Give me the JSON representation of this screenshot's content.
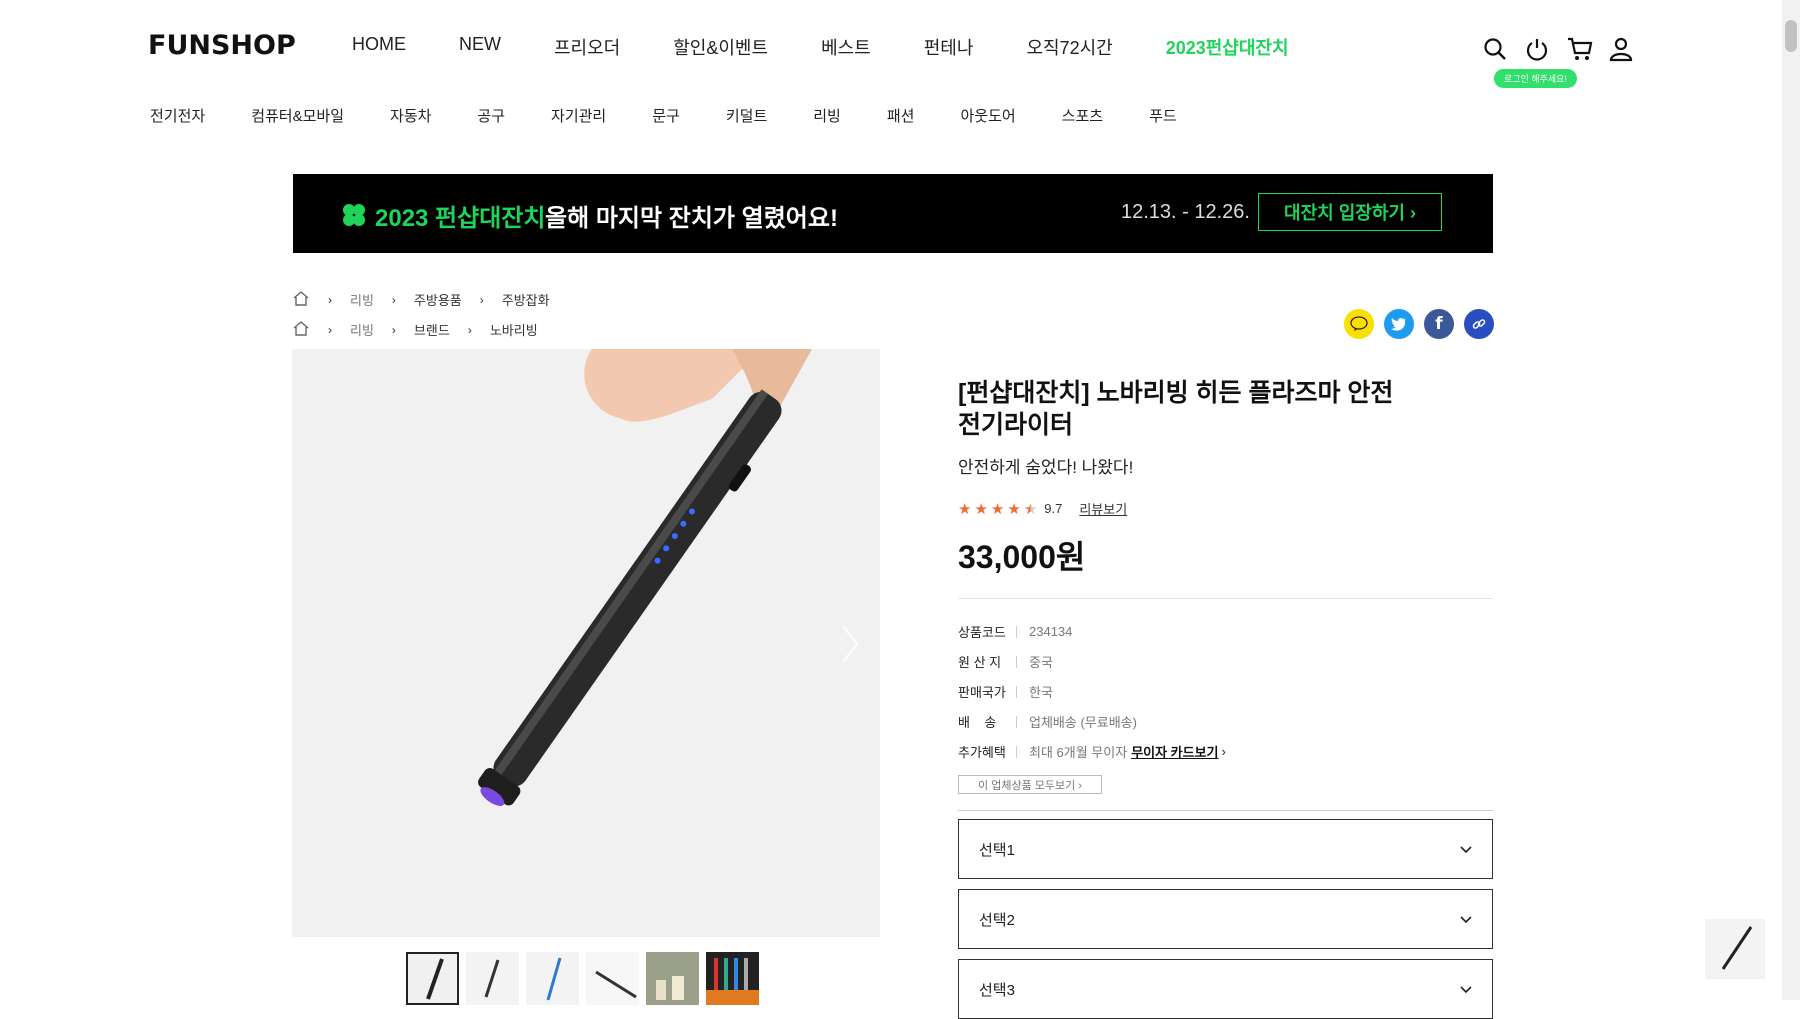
{
  "header": {
    "logo": "FUNSHOP",
    "main_nav": [
      "HOME",
      "NEW",
      "프리오더",
      "할인&이벤트",
      "베스트",
      "펀테나",
      "오직72시간",
      "2023펀샵대잔치"
    ],
    "login_badge": "로그인 해주세요!"
  },
  "category_nav": [
    "전기전자",
    "컴퓨터&모바일",
    "자동차",
    "공구",
    "자기관리",
    "문구",
    "키덜트",
    "리빙",
    "패션",
    "아웃도어",
    "스포츠",
    "푸드"
  ],
  "banner": {
    "title": "2023 펀샵대잔치",
    "subtitle": "올해 마지막 잔치가 열렸어요!",
    "dates": "12.13. - 12.26.",
    "button": "대잔치 입장하기 ›"
  },
  "breadcrumbs": [
    [
      "리빙",
      "주방용품",
      "주방잡화"
    ],
    [
      "리빙",
      "브랜드",
      "노바리빙"
    ]
  ],
  "product": {
    "title": "[펀샵대잔치] 노바리빙 히든 플라즈마 안전 전기라이터",
    "subtitle": "안전하게 숨었다! 나왔다!",
    "rating": "9.7",
    "review_link": "리뷰보기",
    "price": "33,000원",
    "info": [
      {
        "k": "상품코드",
        "v": "234134"
      },
      {
        "k": "원 산 지",
        "v": "중국"
      },
      {
        "k": "판매국가",
        "v": "한국"
      },
      {
        "k": "배    송",
        "v": "업체배송 (무료배송)"
      },
      {
        "k": "추가혜택",
        "v": "최대 6개월 무이자"
      }
    ],
    "card_link": "무이자 카드보기",
    "all_products_btn": "이 업체상품 모두보기 ›",
    "options": [
      "선택1",
      "선택2",
      "선택3"
    ]
  },
  "colors": {
    "accent": "#1ed45a",
    "star": "#f06a3a",
    "kakao": "#f9e000",
    "twitter": "#1d9bf0",
    "facebook": "#3b5998",
    "link": "#2a4ec2"
  }
}
